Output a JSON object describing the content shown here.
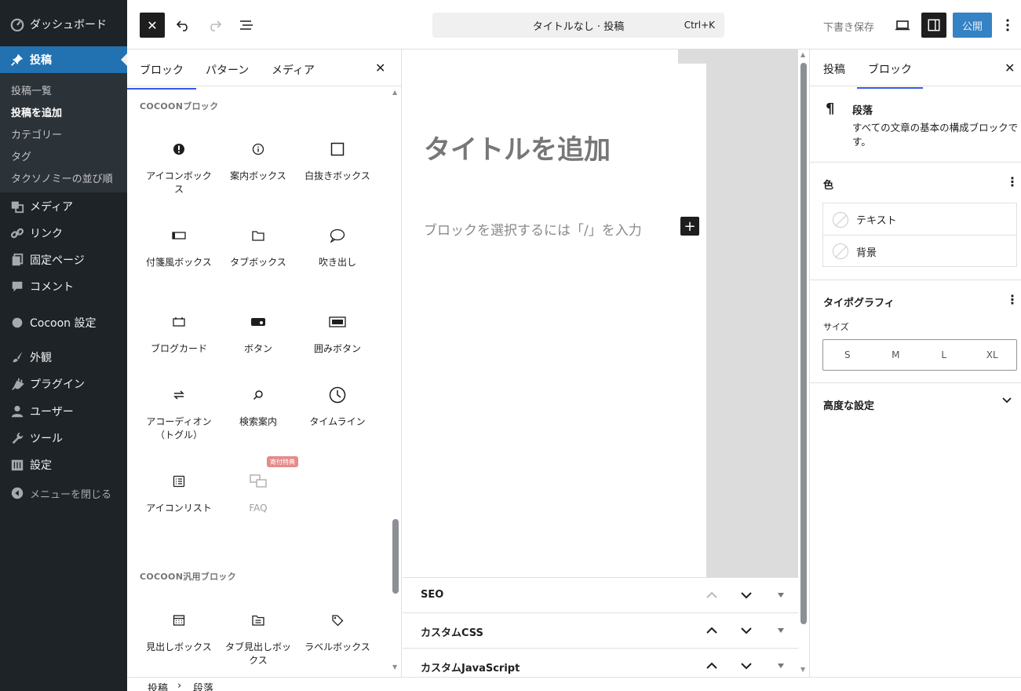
{
  "admin_menu": {
    "items": [
      {
        "label": "ダッシュボード",
        "icon": "dashboard-icon"
      },
      {
        "label": "投稿",
        "icon": "pushpin-icon"
      },
      {
        "label": "メディア",
        "icon": "media-icon"
      },
      {
        "label": "リンク",
        "icon": "link-icon"
      },
      {
        "label": "固定ページ",
        "icon": "page-icon"
      },
      {
        "label": "コメント",
        "icon": "comment-icon"
      },
      {
        "label": "Cocoon 設定",
        "icon": "circle-icon"
      },
      {
        "label": "外観",
        "icon": "brush-icon"
      },
      {
        "label": "プラグイン",
        "icon": "plug-icon"
      },
      {
        "label": "ユーザー",
        "icon": "user-icon"
      },
      {
        "label": "ツール",
        "icon": "wrench-icon"
      },
      {
        "label": "設定",
        "icon": "settings-icon"
      }
    ],
    "submenu": [
      "投稿一覧",
      "投稿を追加",
      "カテゴリー",
      "タグ",
      "タクソノミーの並び順"
    ],
    "collapse_label": "メニューを閉じる"
  },
  "topbar": {
    "doc_title": "タイトルなし · 投稿",
    "shortcut": "Ctrl+K",
    "save_draft": "下書き保存",
    "publish": "公開"
  },
  "inserter": {
    "tabs": [
      "ブロック",
      "パターン",
      "メディア"
    ],
    "category1": "COCOONブロック",
    "blocks": [
      {
        "label": "アイコンボックス",
        "icon": "alert-icon"
      },
      {
        "label": "案内ボックス",
        "icon": "info-icon"
      },
      {
        "label": "白抜きボックス",
        "icon": "square-icon"
      },
      {
        "label": "付箋風ボックス",
        "icon": "sticky-note-icon"
      },
      {
        "label": "タブボックス",
        "icon": "folder-icon"
      },
      {
        "label": "吹き出し",
        "icon": "speech-bubble-icon"
      },
      {
        "label": "ブログカード",
        "icon": "card-icon"
      },
      {
        "label": "ボタン",
        "icon": "button-icon"
      },
      {
        "label": "囲みボタン",
        "icon": "framed-button-icon"
      },
      {
        "label": "アコーディオン（トグル）",
        "icon": "toggle-icon"
      },
      {
        "label": "検索案内",
        "icon": "search-icon"
      },
      {
        "label": "タイムライン",
        "icon": "clock-icon"
      },
      {
        "label": "アイコンリスト",
        "icon": "list-icon"
      },
      {
        "label": "FAQ",
        "icon": "faq-icon"
      }
    ],
    "faq_badge": "寄付特典",
    "category2": "COCOON汎用ブロック",
    "blocks2": [
      {
        "label": "見出しボックス",
        "icon": "calendar-icon"
      },
      {
        "label": "タブ見出しボックス",
        "icon": "folder-text-icon"
      },
      {
        "label": "ラベルボックス",
        "icon": "tag-icon"
      }
    ]
  },
  "canvas": {
    "title_placeholder": "タイトルを追加",
    "paragraph_placeholder": "ブロックを選択するには「/」を入力"
  },
  "metaboxes": [
    "SEO",
    "カスタムCSS",
    "カスタムJavaScript"
  ],
  "settings": {
    "tabs": [
      "投稿",
      "ブロック"
    ],
    "block_title": "段落",
    "block_desc": "すべての文章の基本の構成ブロックです。",
    "color_heading": "色",
    "color_text": "テキスト",
    "color_bg": "背景",
    "typography_heading": "タイポグラフィ",
    "size_label": "サイズ",
    "sizes": [
      "S",
      "M",
      "L",
      "XL"
    ],
    "advanced": "高度な設定"
  },
  "breadcrumb": [
    "投稿",
    "段落"
  ]
}
